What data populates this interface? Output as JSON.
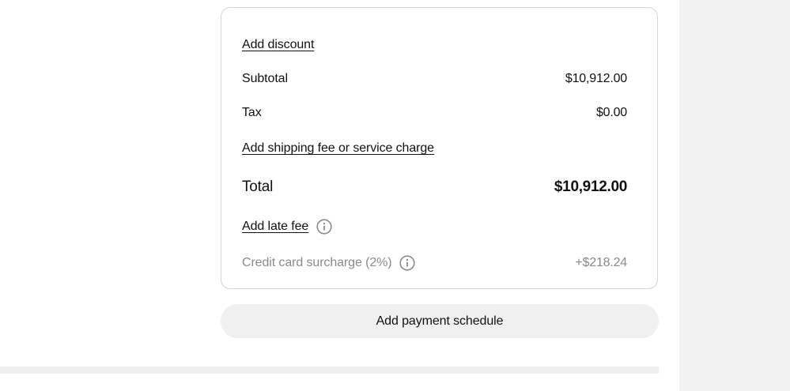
{
  "summary": {
    "add_discount": "Add discount",
    "subtotal_label": "Subtotal",
    "subtotal_value": "$10,912.00",
    "tax_label": "Tax",
    "tax_value": "$0.00",
    "add_shipping": "Add shipping fee or service charge",
    "total_label": "Total",
    "total_value": "$10,912.00",
    "add_late_fee": "Add late fee",
    "surcharge_label": "Credit card surcharge (2%)",
    "surcharge_value": "+$218.24"
  },
  "actions": {
    "add_payment_schedule": "Add payment schedule"
  },
  "icons": {
    "late_fee_info": "info-icon",
    "surcharge_info": "info-icon"
  },
  "colors": {
    "text": "#111111",
    "muted": "#8a8a8a",
    "card_border": "#d4d4d4",
    "button_bg": "#f0f0f0",
    "side_panel": "#f2f2f2"
  }
}
